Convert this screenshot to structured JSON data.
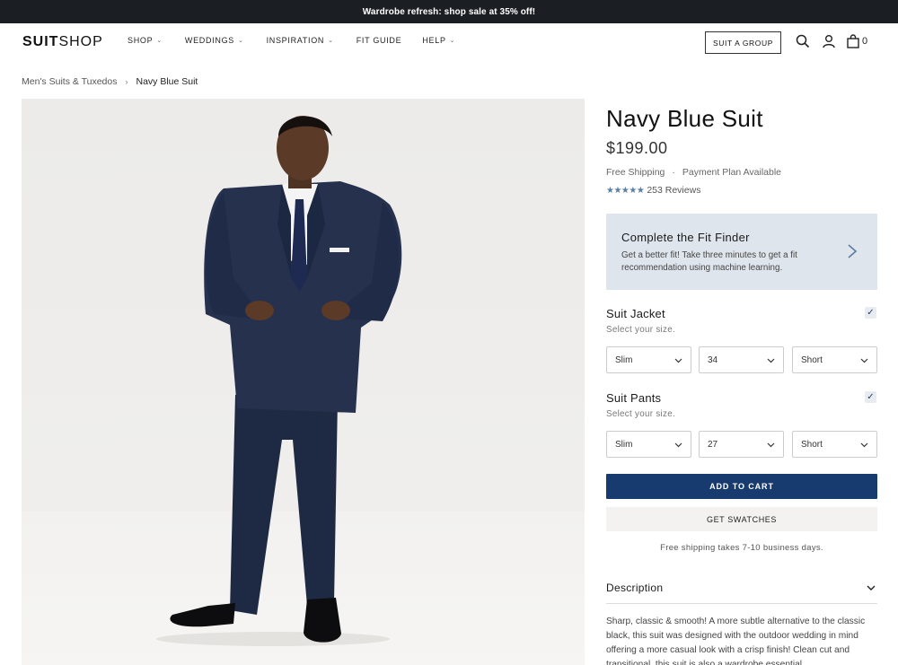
{
  "promo": {
    "text": "Wardrobe refresh: shop sale at 35% off!"
  },
  "header": {
    "logo_bold": "SUIT",
    "logo_light": "SHOP",
    "nav": [
      {
        "label": "SHOP",
        "has_dropdown": true
      },
      {
        "label": "WEDDINGS",
        "has_dropdown": true
      },
      {
        "label": "INSPIRATION",
        "has_dropdown": true
      },
      {
        "label": "FIT GUIDE",
        "has_dropdown": false
      },
      {
        "label": "HELP",
        "has_dropdown": true
      }
    ],
    "group_button": "SUIT A GROUP",
    "icons": [
      "search-icon",
      "account-icon",
      "bag-icon"
    ],
    "cart_count": "0"
  },
  "breadcrumb": {
    "parent": "Men's Suits & Tuxedos",
    "current": "Navy Blue Suit"
  },
  "product": {
    "title": "Navy Blue Suit",
    "price": "$199.00",
    "shipping": "Free Shipping",
    "dot": "·",
    "payment": "Payment Plan Available",
    "stars": "★★★★★",
    "rating_fraction": 1.0,
    "reviews": "253 Reviews",
    "star_color": "#5a7fa3"
  },
  "fit_finder": {
    "title": "Complete the Fit Finder",
    "description": "Get a better fit! Take three minutes to get a fit recommendation using machine learning."
  },
  "jacket": {
    "label": "Suit Jacket",
    "sub": "Select your size.",
    "checked": true,
    "fit": "Slim",
    "size": "34",
    "length": "Short"
  },
  "pants": {
    "label": "Suit Pants",
    "sub": "Select your size.",
    "checked": true,
    "fit": "Slim",
    "size": "27",
    "length": "Short"
  },
  "actions": {
    "add_to_cart": "ADD TO CART",
    "swatches": "GET SWATCHES",
    "ship_note": "Free shipping takes 7-10 business days.",
    "accent": "#173b6e"
  },
  "description": {
    "label": "Description",
    "text": "Sharp, classic & smooth! A more subtle alternative to the classic black, this suit was designed with the outdoor wedding in mind offering a more casual look with a crisp finish! Clean cut and transitional, this suit is also a wardrobe essential."
  }
}
